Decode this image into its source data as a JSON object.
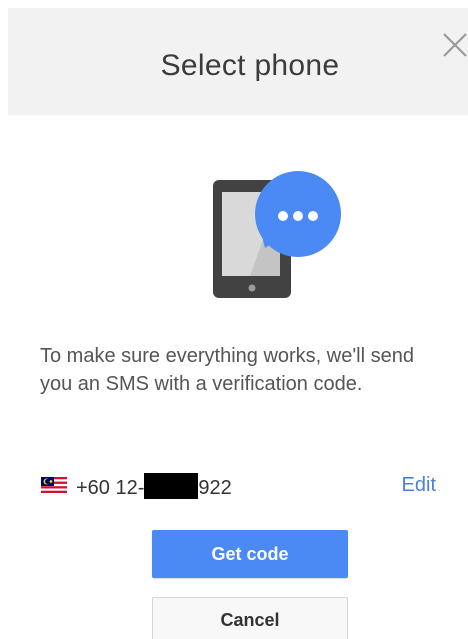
{
  "dialog": {
    "title": "Select phone",
    "close_icon": "close-icon"
  },
  "illustration": {
    "icon": "phone-sms-icon",
    "colors": {
      "phone_body": "#424242",
      "phone_screen": "#d9d9d9",
      "bubble": "#4b8af4"
    }
  },
  "message": {
    "text": "To make sure everything works, we'll send you an SMS with a verification code."
  },
  "phone": {
    "flag_icon": "malaysia-flag-icon",
    "number_prefix": "+60 12-",
    "number_suffix": "922",
    "edit_label": "Edit"
  },
  "actions": {
    "get_code_label": "Get code",
    "cancel_label": "Cancel"
  },
  "colors": {
    "accent": "#4b8af4",
    "link": "#4a7fe0",
    "header_bg": "#f2f2f2"
  }
}
